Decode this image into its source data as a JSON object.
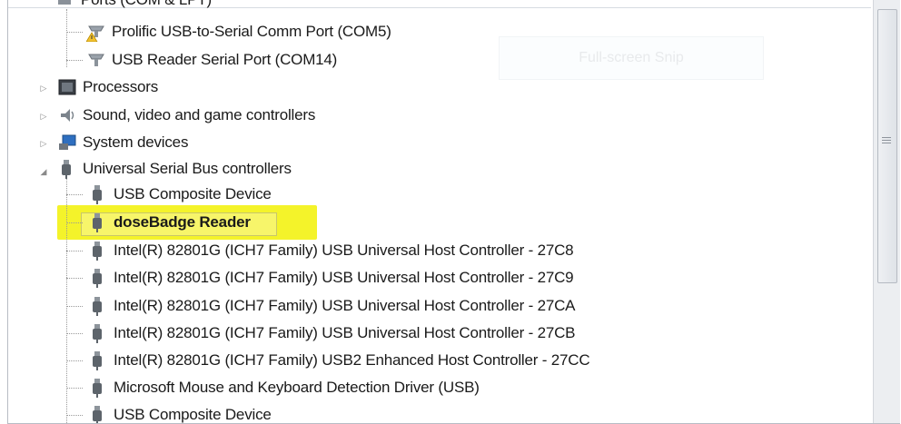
{
  "ghost_tooltip": "Full-screen Snip",
  "rows": [
    {
      "label": "Ports (COM & LPT)",
      "kind": "category"
    },
    {
      "label": "Prolific USB-to-Serial Comm Port (COM5)",
      "kind": "device"
    },
    {
      "label": "USB Reader Serial Port (COM14)",
      "kind": "device"
    },
    {
      "label": "Processors",
      "kind": "category"
    },
    {
      "label": "Sound, video and game controllers",
      "kind": "category"
    },
    {
      "label": "System devices",
      "kind": "category"
    },
    {
      "label": "Universal Serial Bus controllers",
      "kind": "category"
    },
    {
      "label": "USB Composite Device",
      "kind": "device"
    },
    {
      "label": "doseBadge Reader",
      "kind": "device",
      "highlighted": true
    },
    {
      "label": "Intel(R) 82801G (ICH7 Family) USB Universal Host Controller - 27C8",
      "kind": "device"
    },
    {
      "label": "Intel(R) 82801G (ICH7 Family) USB Universal Host Controller - 27C9",
      "kind": "device"
    },
    {
      "label": "Intel(R) 82801G (ICH7 Family) USB Universal Host Controller - 27CA",
      "kind": "device"
    },
    {
      "label": "Intel(R) 82801G (ICH7 Family) USB Universal Host Controller - 27CB",
      "kind": "device"
    },
    {
      "label": "Intel(R) 82801G (ICH7 Family) USB2 Enhanced Host Controller - 27CC",
      "kind": "device"
    },
    {
      "label": "Microsoft Mouse and Keyboard Detection Driver (USB)",
      "kind": "device"
    },
    {
      "label": "USB Composite Device",
      "kind": "device"
    }
  ],
  "icons": {
    "ports": "serial-port-icon",
    "processors": "processor-icon",
    "sound": "speaker-icon",
    "system": "system-devices-icon",
    "usb": "usb-plug-icon",
    "warning": "warning-icon"
  },
  "colors": {
    "highlight": "#f4f32a",
    "tree_lines": "#9a9a9a",
    "scrollbar": "#eceef1"
  }
}
